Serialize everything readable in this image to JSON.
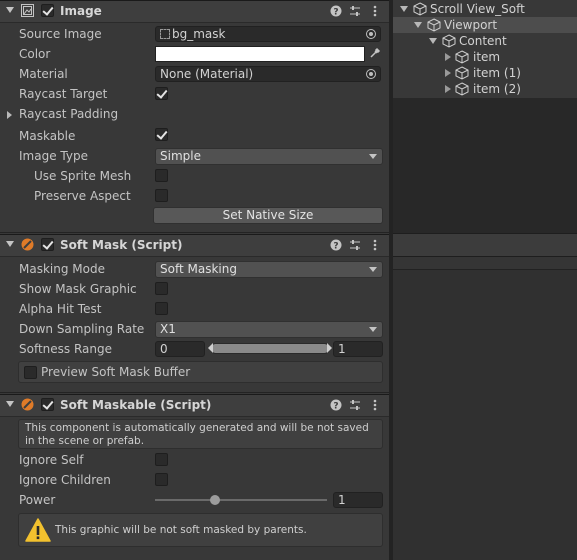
{
  "image_component": {
    "title": "Image",
    "rows": {
      "source_image": {
        "label": "Source Image",
        "value": "bg_mask"
      },
      "color": {
        "label": "Color",
        "value": "#ffffff"
      },
      "material": {
        "label": "Material",
        "value": "None (Material)"
      },
      "raycast_target": {
        "label": "Raycast Target",
        "checked": true
      },
      "raycast_padding": {
        "label": "Raycast Padding"
      },
      "maskable": {
        "label": "Maskable",
        "checked": true
      },
      "image_type": {
        "label": "Image Type",
        "value": "Simple"
      },
      "use_sprite_mesh": {
        "label": "Use Sprite Mesh",
        "checked": false
      },
      "preserve_aspect": {
        "label": "Preserve Aspect",
        "checked": false
      }
    },
    "set_native_size_label": "Set Native Size"
  },
  "soft_mask": {
    "title": "Soft Mask (Script)",
    "rows": {
      "masking_mode": {
        "label": "Masking Mode",
        "value": "Soft Masking"
      },
      "show_mask_graphic": {
        "label": "Show Mask Graphic",
        "checked": false
      },
      "alpha_hit_test": {
        "label": "Alpha Hit Test",
        "checked": false
      },
      "down_sampling_rate": {
        "label": "Down Sampling Rate",
        "value": "X1"
      },
      "softness_range": {
        "label": "Softness Range",
        "min": "0",
        "max": "1"
      }
    },
    "preview_label": "Preview Soft Mask Buffer"
  },
  "soft_maskable": {
    "title": "Soft Maskable (Script)",
    "info_text": "This component is automatically generated and will be not saved in the scene or prefab.",
    "rows": {
      "ignore_self": {
        "label": "Ignore Self",
        "checked": false
      },
      "ignore_children": {
        "label": "Ignore Children",
        "checked": false
      },
      "power": {
        "label": "Power",
        "value": "1",
        "slider_fraction": 0.35
      }
    },
    "warning_text": "This graphic will be not soft masked by parents."
  },
  "hierarchy": {
    "items": [
      {
        "name": "Scroll View_Soft"
      },
      {
        "name": "Viewport"
      },
      {
        "name": "Content"
      },
      {
        "name": "item"
      },
      {
        "name": "item (1)"
      },
      {
        "name": "item (2)"
      }
    ]
  },
  "colors": {
    "panel_bg": "#383838",
    "header_bg": "#3e3e3e",
    "field_bg": "#2a2a2a",
    "selection": "#4d4d4d",
    "warning": "#f2c12e",
    "script_icon": "#e07b28"
  },
  "icons": [
    "image-component-icon",
    "script-icon",
    "help-icon",
    "preset-icon",
    "menu-icon",
    "object-picker-icon",
    "eyedropper-icon",
    "warning-icon",
    "gameobject-cube-icon"
  ]
}
